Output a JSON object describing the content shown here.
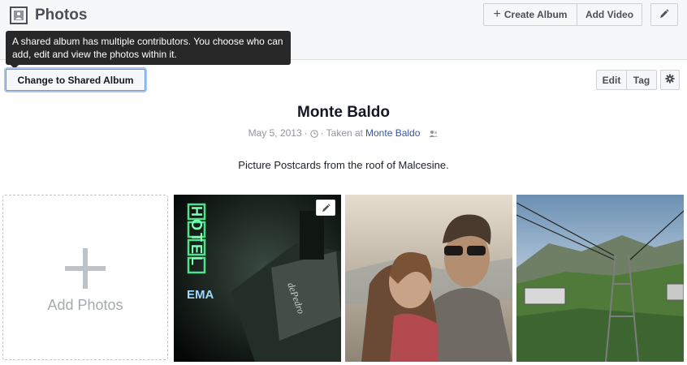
{
  "header": {
    "title": "Photos",
    "icons": {
      "photos": "photos-icon",
      "plus": "plus-icon",
      "pencil": "pencil-icon",
      "gear": "gear-icon"
    },
    "create_album_label": "Create Album",
    "add_video_label": "Add Video"
  },
  "tooltip": {
    "text": "A shared album has multiple contributors. You choose who can add, edit and view the photos within it."
  },
  "album_actions": {
    "change_shared_label": "Change to Shared Album",
    "edit_label": "Edit",
    "tag_label": "Tag"
  },
  "album": {
    "title": "Monte Baldo",
    "date": "May 5, 2013",
    "taken_at_prefix": "Taken at",
    "location": "Monte Baldo",
    "description": "Picture Postcards from the roof of Malcesine.",
    "icons": {
      "clock": "clock-icon",
      "privacy": "friends-icon"
    }
  },
  "grid": {
    "add_photos_label": "Add Photos",
    "photos": [
      {
        "name": "hotel-neon-sign-photo",
        "sign_text": "HOTEL",
        "sub_text": "EMA"
      },
      {
        "name": "couple-portrait-photo"
      },
      {
        "name": "cable-car-mountain-photo"
      }
    ]
  },
  "colors": {
    "link": "#365899",
    "header_bg": "#f6f7f8",
    "tooltip_bg": "#282828",
    "focus_ring": "#6d9bd8"
  }
}
